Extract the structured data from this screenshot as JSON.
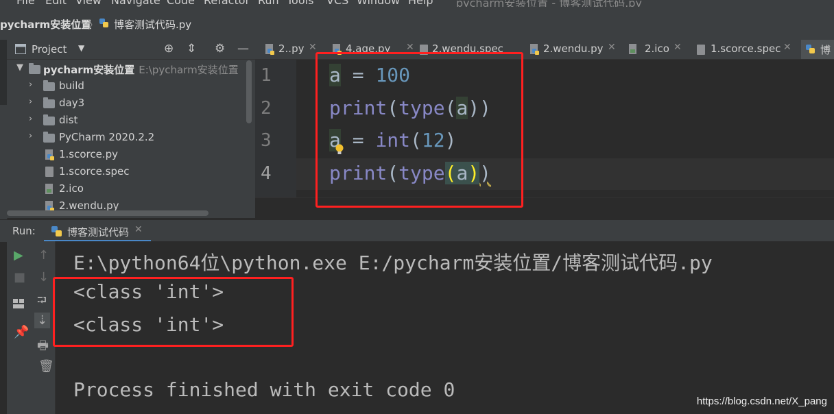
{
  "menu": {
    "items": [
      "File",
      "Edit",
      "View",
      "Navigate",
      "Code",
      "Refactor",
      "Run",
      "Tools",
      "VCS",
      "Window",
      "Help"
    ],
    "window_title": "pycharm安装位置 - 博客测试代码.py"
  },
  "breadcrumb": {
    "project": "pycharm安装位置",
    "file": "博客测试代码.py"
  },
  "project_panel": {
    "title": "Project",
    "root": {
      "name": "pycharm安装位置",
      "path": "E:\\pycharm安装位置"
    },
    "items": [
      {
        "name": "build",
        "kind": "folder"
      },
      {
        "name": "day3",
        "kind": "folder"
      },
      {
        "name": "dist",
        "kind": "folder"
      },
      {
        "name": "PyCharm 2020.2.2",
        "kind": "folder"
      },
      {
        "name": "1.scorce.py",
        "kind": "python"
      },
      {
        "name": "1.scorce.spec",
        "kind": "spec"
      },
      {
        "name": "2.ico",
        "kind": "ico"
      },
      {
        "name": "2.wendu.py",
        "kind": "python"
      }
    ]
  },
  "editor_tabs": [
    "2..py",
    "4.age.py",
    "2.wendu.spec",
    "2.wendu.py",
    "2.ico",
    "1.scorce.spec",
    "博"
  ],
  "editor": {
    "line_numbers": [
      "1",
      "2",
      "3",
      "4"
    ],
    "lines": {
      "l1_var": "a",
      "l1_op": " = ",
      "l1_num": "100",
      "l2_fn": "print",
      "l2_open": "(",
      "l2_type": "type",
      "l2_open2": "(",
      "l2_var": "a",
      "l2_close": "))",
      "l3_var": "a",
      "l3_op": " = ",
      "l3_fn": "int",
      "l3_open": "(",
      "l3_num": "12",
      "l3_close": ")",
      "l4_fn": "print",
      "l4_open": "(",
      "l4_type": "type",
      "l4_open2": "(",
      "l4_var": "a",
      "l4_close2": ")",
      "l4_close": ")"
    }
  },
  "run_panel": {
    "label": "Run:",
    "tab": "博客测试代码",
    "output": [
      "E:\\python64位\\python.exe E:/pycharm安装位置/博客测试代码.py",
      "<class 'int'>",
      "<class 'int'>",
      "",
      "Process finished with exit code 0"
    ]
  },
  "watermark": "https://blog.csdn.net/X_pang",
  "colors": {
    "annotation": "#ff2020",
    "keyword": "#8888c6",
    "number": "#6897bb",
    "run_accent": "#4a88c7"
  }
}
